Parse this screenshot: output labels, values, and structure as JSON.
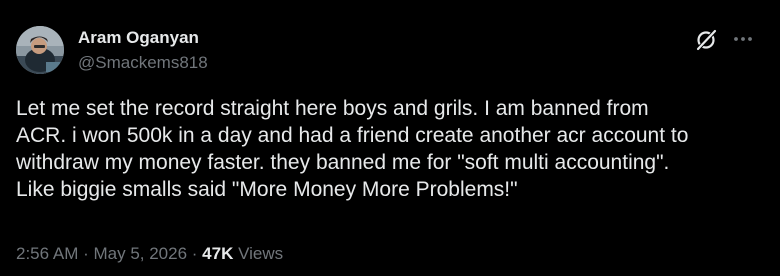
{
  "author": {
    "name": "Aram Oganyan",
    "handle": "@Smackems818"
  },
  "header": {
    "grok_icon": "grok-slash-icon",
    "more_icon": "more-horizontal-icon"
  },
  "tweet": {
    "lines": [
      "Let me set the record straight here boys and grils.  I am banned from",
      "ACR.   i won 500k in a day and had a friend create another acr account to",
      "withdraw my money faster.  they banned me for \"soft multi accounting\".",
      "Like biggie smalls said \"More Money More Problems!\""
    ]
  },
  "meta": {
    "time": "2:56 AM",
    "separator": " · ",
    "date": "May 5, 2026",
    "views_count": "47K",
    "views_label": " Views"
  },
  "colors": {
    "background": "#000000",
    "text_primary": "#e7e9ea",
    "text_secondary": "#71767b"
  }
}
